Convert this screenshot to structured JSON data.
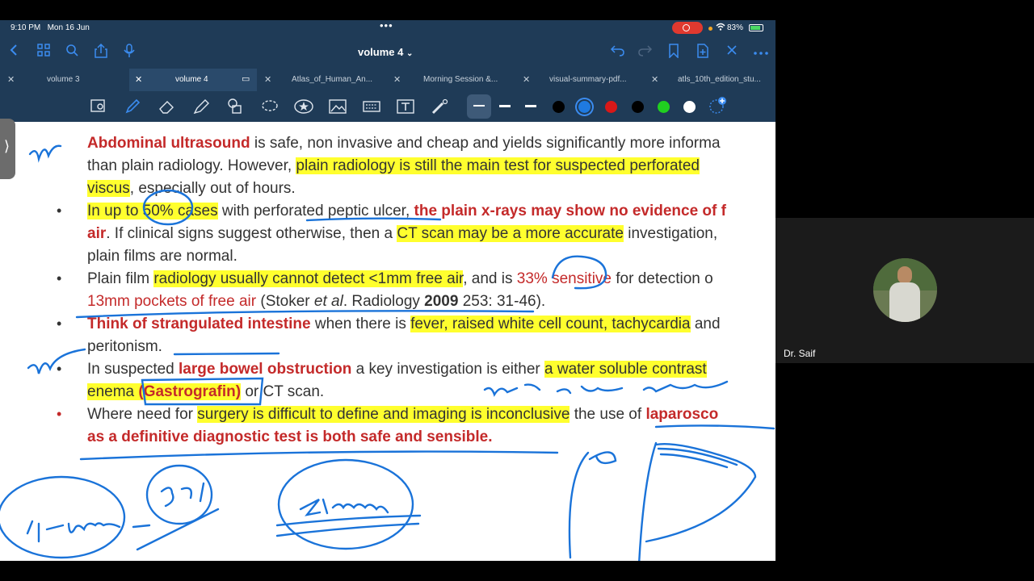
{
  "status_bar": {
    "time": "9:10 PM",
    "date": "Mon 16 Jun",
    "battery": "83%"
  },
  "nav": {
    "title": "volume 4",
    "title_chevron": "⌄"
  },
  "tabs": [
    {
      "label": "volume 3",
      "active": false
    },
    {
      "label": "volume 4",
      "active": true
    },
    {
      "label": "Atlas_of_Human_An...",
      "active": false
    },
    {
      "label": "Morning Session &...",
      "active": false
    },
    {
      "label": "visual-summary-pdf...",
      "active": false
    },
    {
      "label": "atls_10th_edition_stu...",
      "active": false
    }
  ],
  "toolbar_colors": [
    "#000000",
    "#1f7ae0",
    "#d81818",
    "#000000",
    "#20d020",
    "#ffffff"
  ],
  "document": {
    "l0_a": "Abdominal ultrasound",
    "l0_b": " is safe, non invasive and cheap and yields significantly more informa",
    "l1_a": "than plain radiology. However, ",
    "l1_b": "plain radiology is still the main test for suspected perforated",
    "l2_a": "viscus",
    "l2_b": ", especially out of hours.",
    "l3_a": "In up to 50% cases",
    "l3_b": " with perforated peptic ulcer, ",
    "l3_c": "the plain x-rays may show no evidence of f",
    "l4_a": "air",
    "l4_b": ". If clinical signs suggest otherwise, then a ",
    "l4_c": "CT scan may be a more accurate",
    "l4_d": " investigation,",
    "l5": "plain films are normal.",
    "l6_a": "Plain film ",
    "l6_b": "radiology usually cannot detect <1mm free air",
    "l6_c": ", and is ",
    "l6_d": "33% sensitive",
    "l6_e": " for detection o",
    "l7_a": "13mm pockets of free air",
    "l7_b": " (Stoker ",
    "l7_c": "et al",
    "l7_d": ". Radiology ",
    "l7_e": "2009",
    "l7_f": " 253: 31-46).",
    "l8_a": "Think of strangulated intestine",
    "l8_b": " when there is ",
    "l8_c": "fever, raised white cell count, tachycardia",
    "l8_d": " and",
    "l9": "peritonism.",
    "l10_a": "In suspected ",
    "l10_b": "large bowel obstruction",
    "l10_c": " a key investigation is either ",
    "l10_d": "a water soluble contrast",
    "l11_a": "enema ",
    "l11_b": "(Gastrografin)",
    "l11_c": " or CT scan.",
    "l12_a": "Where need for ",
    "l12_b": "surgery is difficult to define and imaging is inconclusive",
    "l12_c": " the use of ",
    "l12_d": "laparosco",
    "l13": "as a definitive diagnostic test is both safe and sensible."
  },
  "participant": {
    "name": "Dr. Saif"
  }
}
